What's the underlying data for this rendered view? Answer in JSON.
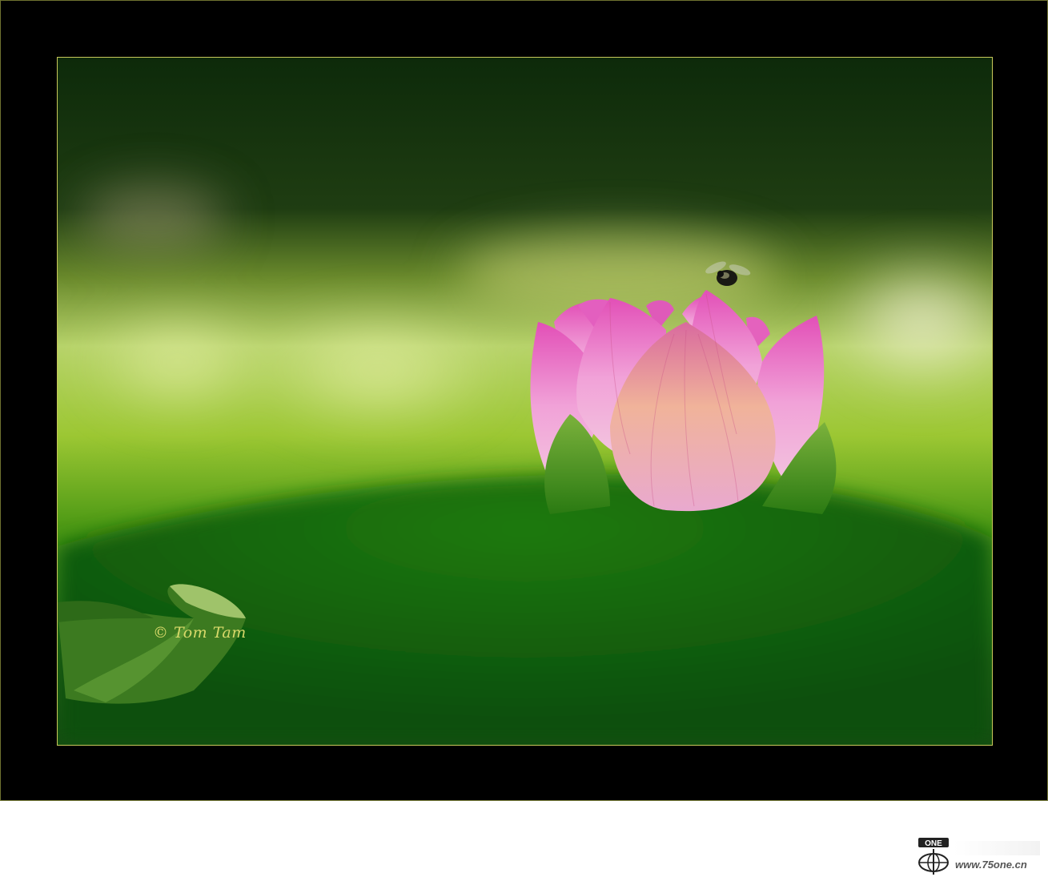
{
  "photo": {
    "subject": "pink-lotus-bud-icon",
    "insect": "bee-icon",
    "leaf": "lotus-leaf-icon",
    "colors": {
      "frame": "#000000",
      "inner_border": "#c8c85a",
      "petal": "#e679c4",
      "leaf_green": "#2f8a12",
      "signature": "#d8d96a"
    }
  },
  "signature": {
    "text": "© Tom Tam"
  },
  "watermark": {
    "logo": "one-globe-logo-icon",
    "url": "www.75one.cn"
  }
}
